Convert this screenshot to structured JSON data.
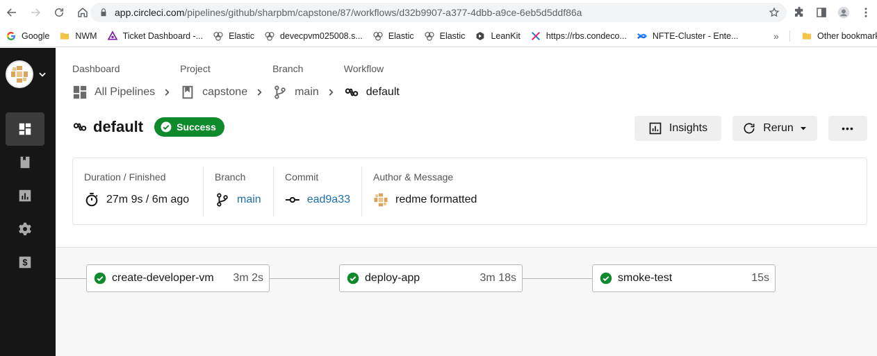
{
  "browser": {
    "url_host": "app.circleci.com",
    "url_path": "/pipelines/github/sharpbm/capstone/87/workflows/d32b9907-a377-4dbb-a9ce-6eb5d5ddf86a",
    "bookmarks": [
      {
        "label": "Google",
        "icon": "google-icon"
      },
      {
        "label": "NWM",
        "icon": "folder-icon"
      },
      {
        "label": "Ticket Dashboard -...",
        "icon": "ticket-icon"
      },
      {
        "label": "Elastic",
        "icon": "elastic-icon"
      },
      {
        "label": "devecpvm025008.s...",
        "icon": "elastic-icon"
      },
      {
        "label": "Elastic",
        "icon": "elastic-icon"
      },
      {
        "label": "Elastic",
        "icon": "elastic-icon"
      },
      {
        "label": "LeanKit",
        "icon": "leankit-icon"
      },
      {
        "label": "https://rbs.condeco...",
        "icon": "condeco-icon"
      },
      {
        "label": "NFTE-Cluster - Ente...",
        "icon": "confluence-icon"
      }
    ],
    "overflow": "»",
    "other_bookmarks": "Other bookmarks"
  },
  "breadcrumbs": [
    {
      "label": "Dashboard",
      "value": "All Pipelines",
      "icon": "dashboard-icon"
    },
    {
      "label": "Project",
      "value": "capstone",
      "icon": "project-icon"
    },
    {
      "label": "Branch",
      "value": "main",
      "icon": "branch-icon"
    },
    {
      "label": "Workflow",
      "value": "default",
      "icon": "workflow-icon"
    }
  ],
  "workflow": {
    "title": "default",
    "status": "Success"
  },
  "actions": {
    "insights": "Insights",
    "rerun": "Rerun",
    "more": "•••"
  },
  "summary": {
    "duration_label": "Duration / Finished",
    "duration_value": "27m 9s / 6m ago",
    "branch_label": "Branch",
    "branch_value": "main",
    "commit_label": "Commit",
    "commit_value": "ead9a33",
    "author_label": "Author & Message",
    "author_message": "redme formatted"
  },
  "jobs": [
    {
      "name": "create-developer-vm",
      "duration": "3m 2s",
      "status": "success"
    },
    {
      "name": "deploy-app",
      "duration": "3m 18s",
      "status": "success"
    },
    {
      "name": "smoke-test",
      "duration": "15s",
      "status": "success"
    }
  ],
  "colors": {
    "success": "#0e8a2c",
    "link": "#1e6fa8",
    "sidebar": "#161616"
  }
}
